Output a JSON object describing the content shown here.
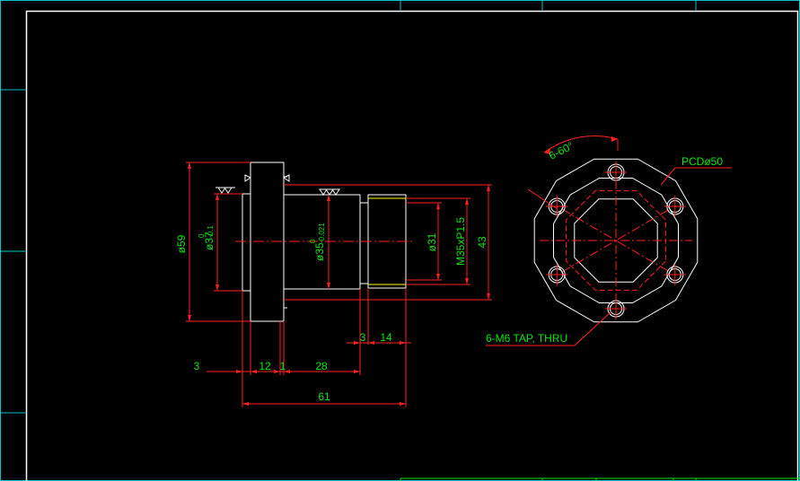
{
  "colors": {
    "background": "#000000",
    "outline": "#ffffff",
    "dimension": "#ff2020",
    "text": "#00e600",
    "frame": "#00c8c8",
    "yellow": "#ffff00"
  },
  "side_view": {
    "flange_diameter": "ø59",
    "pilot_diameter": "ø37",
    "pilot_tol_upper": "0",
    "pilot_tol_lower": "-0.1",
    "body_diameter": "ø35",
    "body_tol_upper": "0",
    "body_tol_lower": "-0.021",
    "bore_diameter": "ø31",
    "thread": "M35xP1.5",
    "outer_height": "43"
  },
  "horizontal_dims": {
    "d3_left": "3",
    "d12": "12",
    "d1": "1",
    "d28": "28",
    "d3_right": "3",
    "d14": "14",
    "overall": "61"
  },
  "front_view": {
    "angle_note": "6-60°",
    "pcd_note": "PCDø50",
    "tap_note": "6-M6 TAP, THRU"
  },
  "icons": [
    "surface-finish-icon"
  ]
}
